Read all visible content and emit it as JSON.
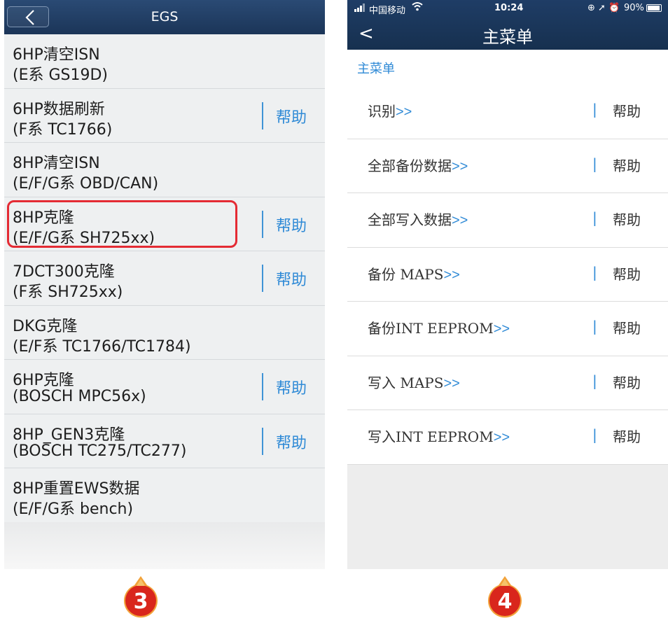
{
  "left": {
    "title": "EGS",
    "items": [
      {
        "line1": "6HP清空ISN",
        "line2": "(E系 GS19D)",
        "help": ""
      },
      {
        "line1": "6HP数据刷新",
        "line2": "(F系 TC1766)",
        "help": "帮助"
      },
      {
        "line1": "8HP清空ISN",
        "line2": "(E/F/G系 OBD/CAN)",
        "help": ""
      },
      {
        "line1": "8HP克隆",
        "line2": "(E/F/G系 SH725xx)",
        "help": "帮助"
      },
      {
        "line1": "7DCT300克隆",
        "line2": "(F系 SH725xx)",
        "help": "帮助"
      },
      {
        "line1": "DKG克隆",
        "line2": "(E/F系 TC1766/TC1784)",
        "help": ""
      },
      {
        "line1": "6HP克隆",
        "line2": "(BOSCH MPC56x)",
        "help": "帮助"
      },
      {
        "line1": "8HP_GEN3克隆",
        "line2": "(BOSCH TC275/TC277)",
        "help": "帮助"
      },
      {
        "line1": "8HP重置EWS数据",
        "line2": "(E/F/G系 bench)",
        "help": ""
      }
    ],
    "highlight_color": "#e42b34"
  },
  "right": {
    "status": {
      "carrier": "中国移动",
      "time": "10:24",
      "battery": "90%",
      "icons": "⊕ ➚ ⏰"
    },
    "title": "主菜单",
    "back_glyph": "<",
    "breadcrumb": "主菜单",
    "items": [
      {
        "label": "识别",
        "arrow": ">>",
        "sep": "|",
        "help": "帮助"
      },
      {
        "label": "全部备份数据",
        "arrow": ">>",
        "sep": "|",
        "help": "帮助"
      },
      {
        "label": "全部写入数据",
        "arrow": ">>",
        "sep": "|",
        "help": "帮助"
      },
      {
        "label": "备份 MAPS",
        "arrow": ">>",
        "sep": "|",
        "help": "帮助"
      },
      {
        "label": "备份INT EEPROM",
        "arrow": ">>",
        "sep": "|",
        "help": "帮助"
      },
      {
        "label": "写入 MAPS",
        "arrow": ">>",
        "sep": "|",
        "help": "帮助"
      },
      {
        "label": "写入INT EEPROM",
        "arrow": ">>",
        "sep": "|",
        "help": "帮助"
      }
    ]
  },
  "badges": {
    "left": "3",
    "right": "4"
  },
  "colors": {
    "header": "#1b3558",
    "accent_blue": "#2f8ad6",
    "badge_red": "#d9261c"
  }
}
